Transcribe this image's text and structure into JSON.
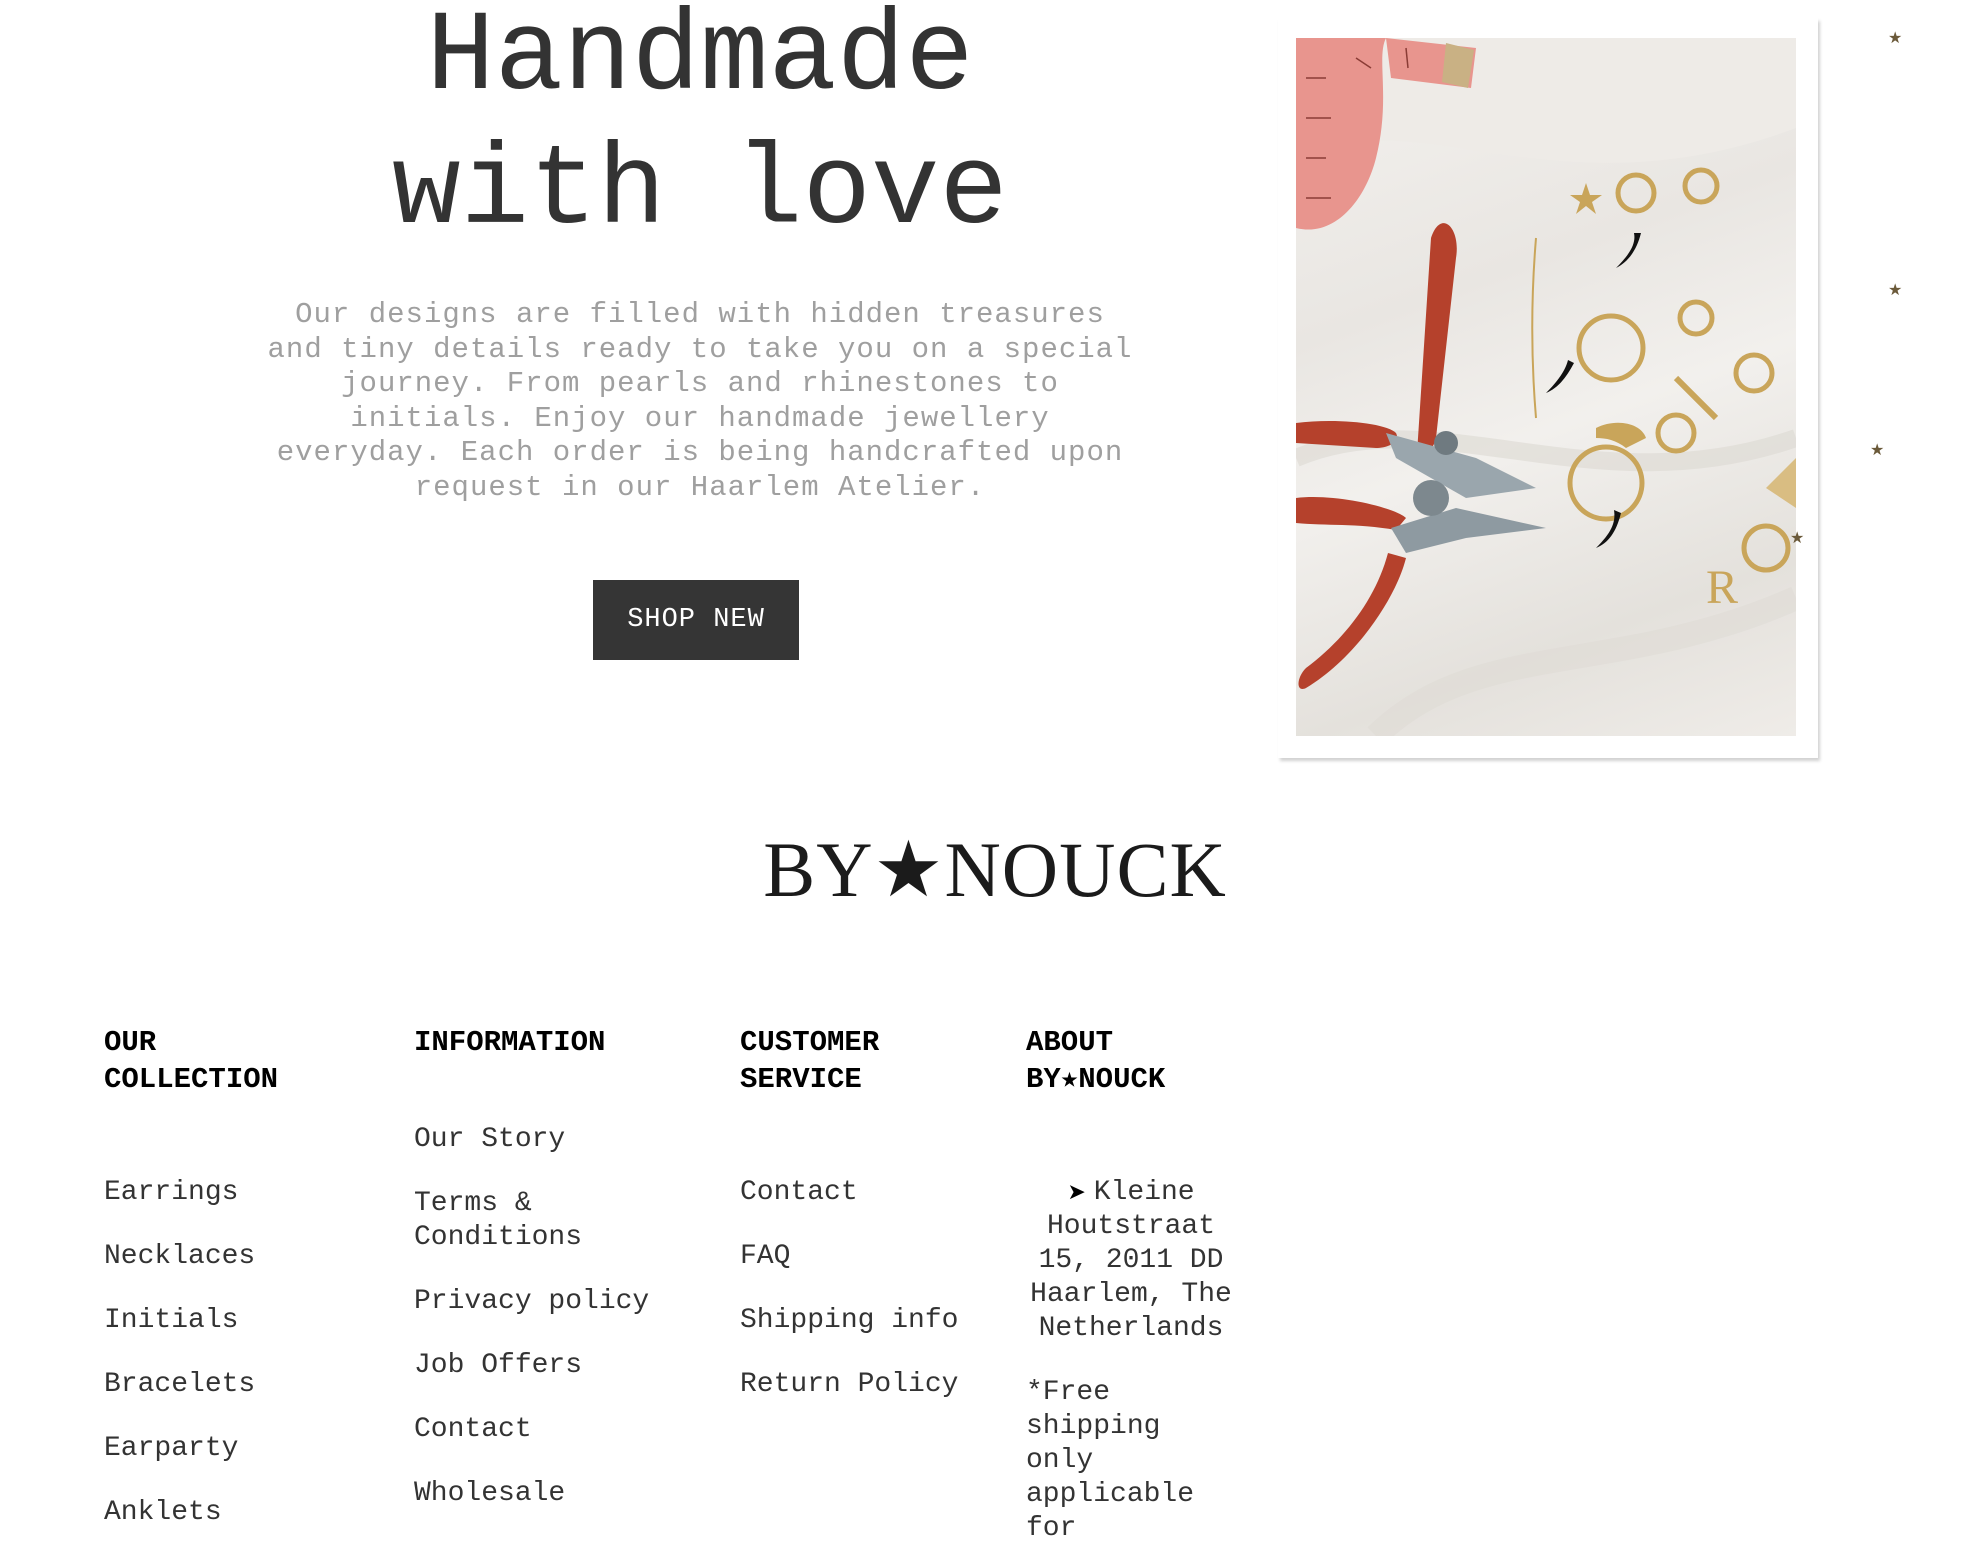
{
  "hero": {
    "title_line1": "Handmade",
    "title_line2": "with love",
    "description": "Our designs are filled with hidden treasures and tiny details ready to take you on a special journey. From pearls and rhinestones to initials. Enjoy our handmade jewellery everyday. Each order is being handcrafted upon request in our Haarlem Atelier.",
    "cta_label": "SHOP NEW"
  },
  "image": {
    "icon": "jewellery-photo",
    "alt": "Pliers, measuring tape and gold earrings on white satin"
  },
  "logo": {
    "text": "BY★NOUCK"
  },
  "footer": {
    "collection": {
      "heading_line1": "OUR",
      "heading_line2": "COLLECTION",
      "items": [
        "Earrings",
        "Necklaces",
        "Initials",
        "Bracelets",
        "Earparty",
        "Anklets"
      ]
    },
    "information": {
      "heading": "INFORMATION",
      "items": [
        "Our Story",
        "Terms & Conditions",
        "Privacy policy",
        "Job Offers",
        "Contact",
        "Wholesale"
      ]
    },
    "customer_service": {
      "heading_line1": "CUSTOMER",
      "heading_line2": "SERVICE",
      "items": [
        "Contact",
        "FAQ",
        "Shipping info",
        "Return Policy"
      ]
    },
    "about": {
      "heading_line1": "ABOUT",
      "heading_line2": "BY★NOUCK",
      "address_icon": "arrow-icon",
      "address": "Kleine Houtstraat 15, 2011 DD Haarlem, The Netherlands",
      "shipping_note": "*Free shipping only applicable for"
    }
  },
  "colors": {
    "button_bg": "#353535",
    "text_dark": "#333333",
    "text_muted": "#9f9f9f"
  }
}
